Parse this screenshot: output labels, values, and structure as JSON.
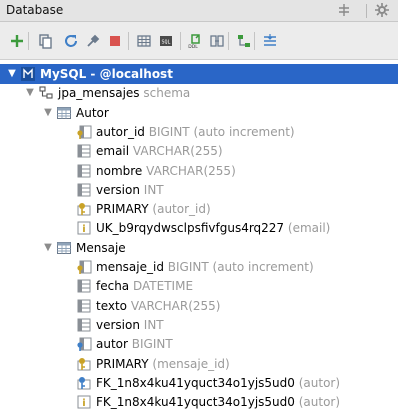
{
  "panel": {
    "title": "Database",
    "icons": [
      "split-icon",
      "gear-icon"
    ]
  },
  "toolbar": {
    "buttons": [
      {
        "name": "add-icon",
        "color": "#3c9a3c"
      },
      {
        "name": "copy-icon",
        "color": "#6b7a8c"
      },
      {
        "name": "refresh-icon",
        "color": "#3f7fc7"
      },
      {
        "name": "tools-icon",
        "color": "#6b7a8c"
      },
      {
        "name": "stop-icon",
        "color": "#d9534f"
      },
      {
        "name": "table-view-icon",
        "color": "#6b7a8c"
      },
      {
        "name": "console-icon",
        "color": "#4a4a4a"
      },
      {
        "name": "ddl-icon",
        "color": "#3c9a3c"
      },
      {
        "name": "diff-icon",
        "color": "#6b7a8c"
      },
      {
        "name": "diagram-icon",
        "color": "#3c9a3c"
      },
      {
        "name": "filter-icon",
        "color": "#3f7fc7"
      }
    ]
  },
  "tree": {
    "datasource": {
      "label": "MySQL - @localhost"
    },
    "schema": {
      "name": "jpa_mensajes",
      "suffix": "schema"
    },
    "tables": [
      {
        "name": "Autor",
        "items": [
          {
            "kind": "key-column",
            "name": "autor_id",
            "detail": "BIGINT (auto increment)"
          },
          {
            "kind": "column",
            "name": "email",
            "detail": "VARCHAR(255)"
          },
          {
            "kind": "column",
            "name": "nombre",
            "detail": "VARCHAR(255)"
          },
          {
            "kind": "column",
            "name": "version",
            "detail": "INT"
          },
          {
            "kind": "primary-key",
            "name": "PRIMARY",
            "detail": "(autor_id)"
          },
          {
            "kind": "index",
            "name": "UK_b9rqydwsclpsfivfgus4rq227",
            "detail": "(email)"
          }
        ]
      },
      {
        "name": "Mensaje",
        "items": [
          {
            "kind": "key-column",
            "name": "mensaje_id",
            "detail": "BIGINT (auto increment)"
          },
          {
            "kind": "column",
            "name": "fecha",
            "detail": "DATETIME"
          },
          {
            "kind": "column",
            "name": "texto",
            "detail": "VARCHAR(255)"
          },
          {
            "kind": "column",
            "name": "version",
            "detail": "INT"
          },
          {
            "kind": "fk-column",
            "name": "autor",
            "detail": "BIGINT"
          },
          {
            "kind": "primary-key",
            "name": "PRIMARY",
            "detail": "(mensaje_id)"
          },
          {
            "kind": "foreign-key",
            "name": "FK_1n8x4ku41yquct34o1yjs5ud0",
            "detail": "(autor)"
          },
          {
            "kind": "index",
            "name": "FK_1n8x4ku41yquct34o1yjs5ud0",
            "detail": "(autor)"
          }
        ]
      }
    ]
  },
  "colors": {
    "selection": "#2a66c7",
    "type_text": "#9a9a9a",
    "key_gold": "#c9a227",
    "column_gray": "#8a8f96"
  }
}
